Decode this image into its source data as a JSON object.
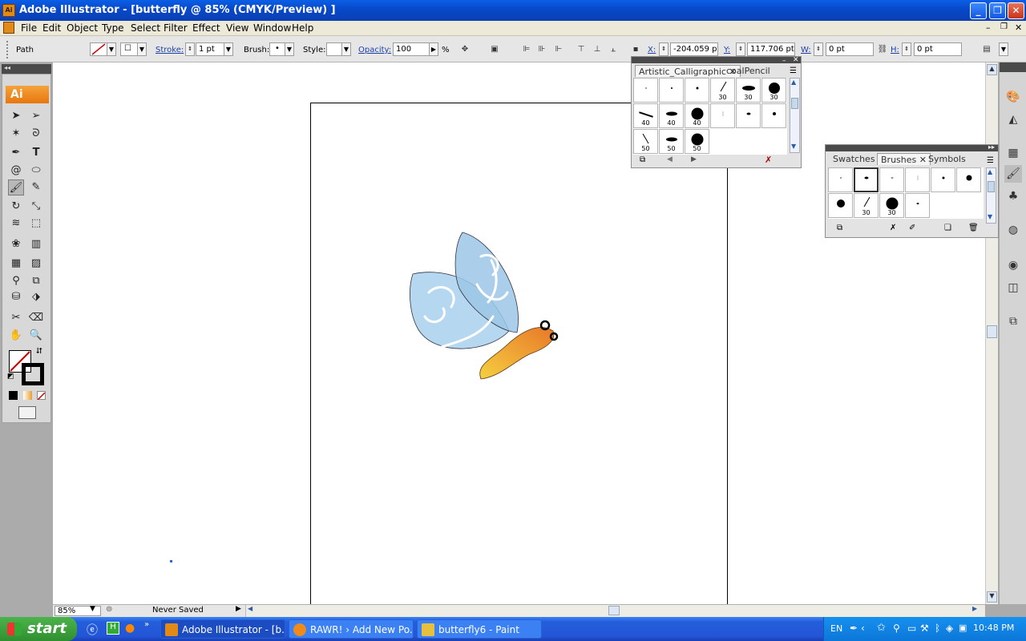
{
  "window": {
    "title": "Adobe Illustrator - [butterfly @ 85% (CMYK/Preview) ]",
    "app_icon": "Ai"
  },
  "menu": [
    "File",
    "Edit",
    "Object",
    "Type",
    "Select",
    "Filter",
    "Effect",
    "View",
    "Window",
    "Help"
  ],
  "control": {
    "object_type": "Path",
    "stroke_label": "Stroke:",
    "stroke_value": "1 pt",
    "brush_label": "Brush:",
    "style_label": "Style:",
    "opacity_label": "Opacity:",
    "opacity_value": "100",
    "opacity_unit": "%",
    "x_label": "X:",
    "x_value": "-204.059 pt",
    "y_label": "Y:",
    "y_value": "117.706 pt",
    "w_label": "W:",
    "w_value": "0 pt",
    "h_label": "H:",
    "h_value": "0 pt"
  },
  "toolbox_logo": "Ai",
  "calligraphic_panel": {
    "tabs": [
      "Artistic_Calligraphic",
      "coalPencil"
    ],
    "rows": [
      [
        "",
        "",
        "",
        "30",
        "30",
        "30"
      ],
      [
        "40",
        "40",
        "40",
        "",
        "",
        ""
      ],
      [
        "50",
        "50",
        "50"
      ]
    ]
  },
  "brushes_panel": {
    "tabs": [
      "Swatches",
      "Brushes",
      "Symbols"
    ],
    "rows": [
      [
        "",
        "",
        "",
        "",
        "",
        ""
      ],
      [
        "",
        "30",
        "30",
        ""
      ]
    ]
  },
  "status": {
    "zoom": "85%",
    "state": "Never Saved"
  },
  "taskbar": {
    "start": "start",
    "tasks": [
      "Adobe Illustrator - [b...",
      "RAWR! › Add New Po...",
      "butterfly6 - Paint"
    ],
    "lang": "EN",
    "clock": "10:48 PM"
  },
  "colors": {
    "accent": "#0a5fe6",
    "wing": "#a8d0ec",
    "body_start": "#f5d040",
    "body_end": "#e8782a",
    "brush_logo": "#e8760e"
  }
}
